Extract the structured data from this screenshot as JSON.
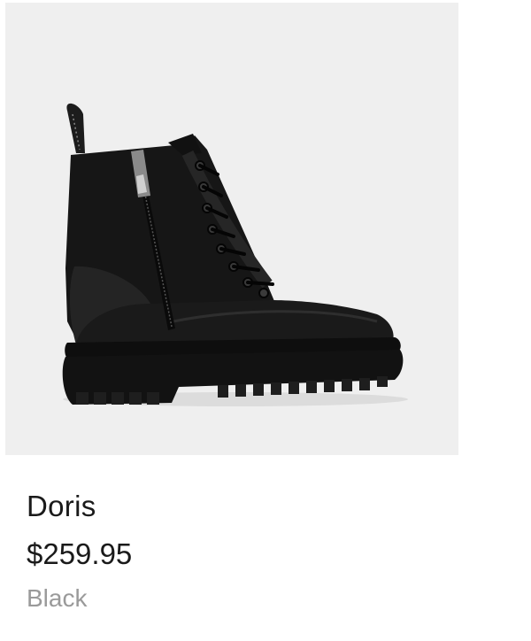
{
  "product": {
    "name": "Doris",
    "price": "$259.95",
    "color": "Black",
    "image_icon": "black-lace-up-combat-boot"
  }
}
